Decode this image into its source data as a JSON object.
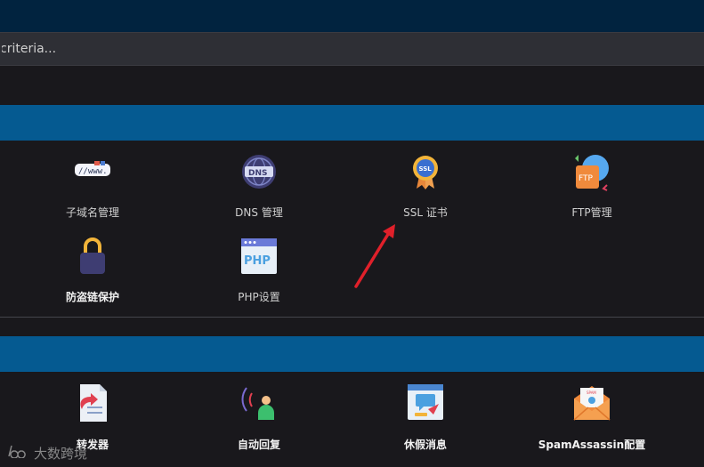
{
  "search": {
    "placeholder": "criteria..."
  },
  "sections": {
    "domains": {
      "items": [
        {
          "label": "子域名管理",
          "icon": "subdomain-icon"
        },
        {
          "label": "DNS 管理",
          "icon": "dns-globe-icon"
        },
        {
          "label": "SSL 证书",
          "icon": "ssl-badge-icon"
        },
        {
          "label": "FTP管理",
          "icon": "ftp-globe-icon"
        },
        {
          "label": "防盗链保护",
          "icon": "lock-icon"
        },
        {
          "label": "PHP设置",
          "icon": "php-window-icon"
        }
      ]
    },
    "email": {
      "items": [
        {
          "label": "转发器",
          "icon": "forwarder-document-icon"
        },
        {
          "label": "自动回复",
          "icon": "autoresponder-person-icon"
        },
        {
          "label": "休假消息",
          "icon": "vacation-message-icon"
        },
        {
          "label": "SpamAssassin配置",
          "icon": "spam-envelope-icon"
        }
      ]
    }
  },
  "watermark": {
    "text": "大数跨境"
  },
  "colors": {
    "topbar": "#01233f",
    "section_band": "#055a91",
    "background": "#19181c",
    "annotation_arrow": "#e0202a"
  }
}
